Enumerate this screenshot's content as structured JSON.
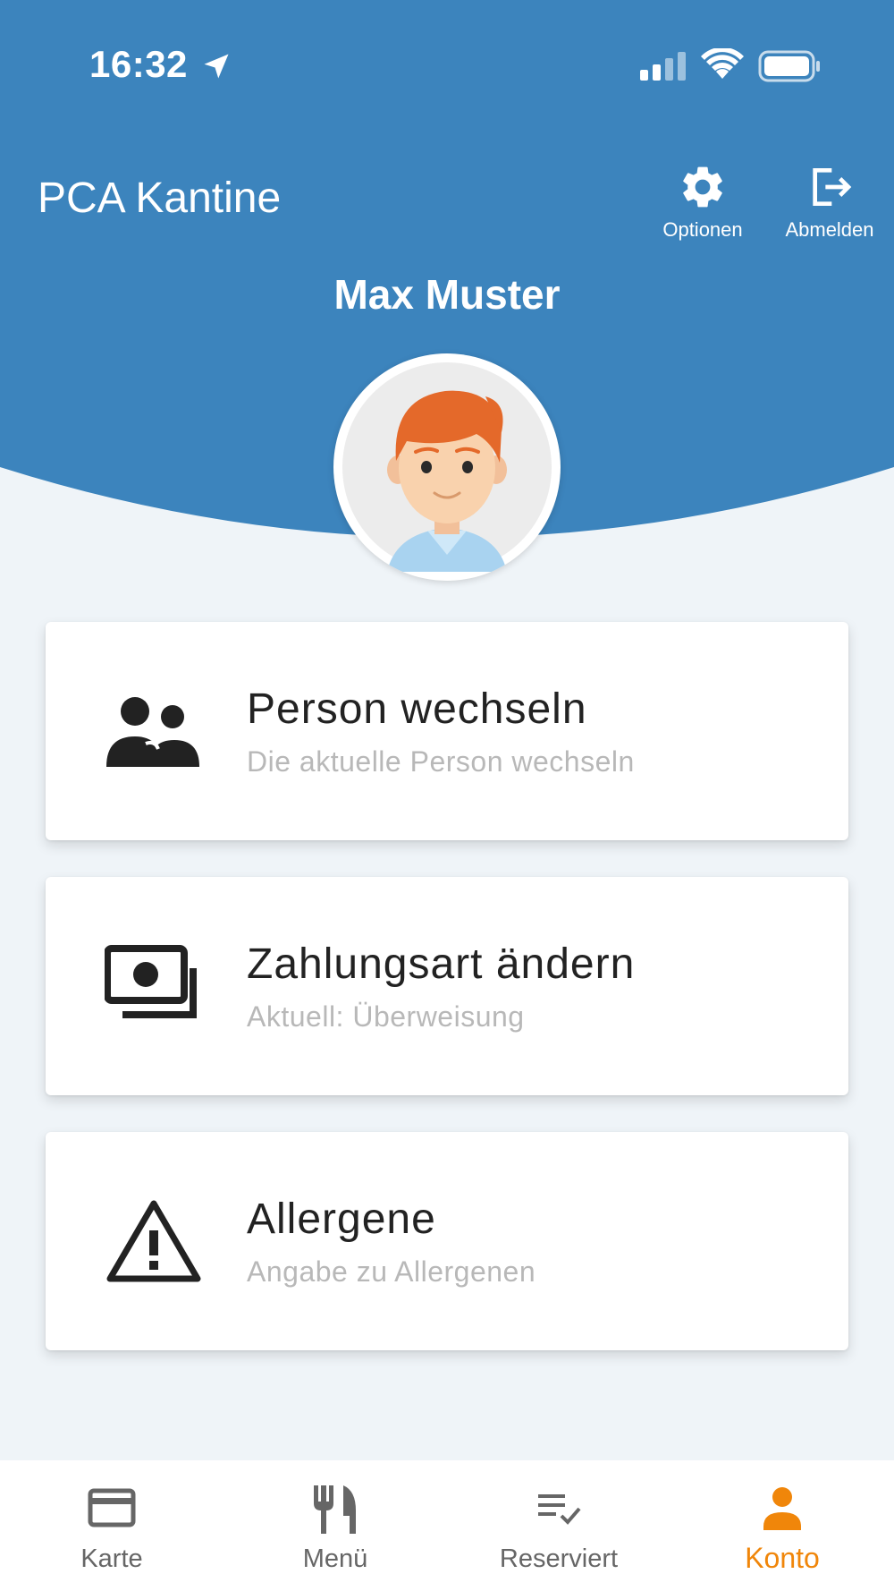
{
  "status_bar": {
    "time": "16:32"
  },
  "header": {
    "app_title": "PCA Kantine",
    "options_label": "Optionen",
    "logout_label": "Abmelden",
    "user_name": "Max Muster"
  },
  "cards": [
    {
      "title": "Person wechseln",
      "subtitle": "Die aktuelle Person wechseln",
      "icon": "people-icon"
    },
    {
      "title": "Zahlungsart ändern",
      "subtitle": "Aktuell: Überweisung",
      "icon": "payments-icon"
    },
    {
      "title": "Allergene",
      "subtitle": "Angabe zu Allergenen",
      "icon": "warning-icon"
    }
  ],
  "bottom_nav": {
    "items": [
      {
        "label": "Karte",
        "icon": "card-icon"
      },
      {
        "label": "Menü",
        "icon": "cutlery-icon"
      },
      {
        "label": "Reserviert",
        "icon": "checklist-icon"
      },
      {
        "label": "Konto",
        "icon": "person-icon",
        "active": true
      }
    ]
  },
  "colors": {
    "header_blue": "#3c84bd",
    "accent_orange": "#f0860a",
    "background": "#eff4f8"
  }
}
